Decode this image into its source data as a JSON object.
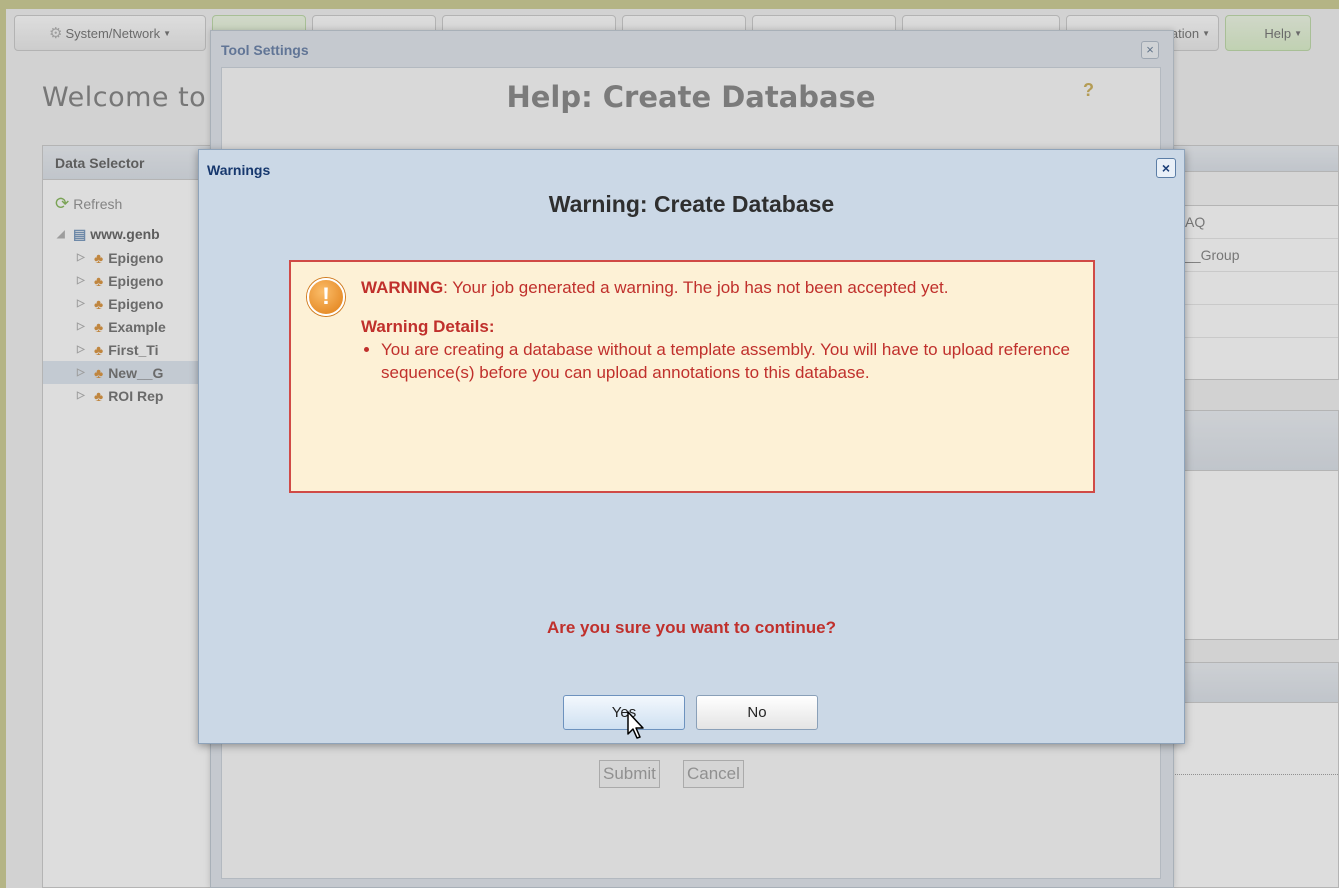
{
  "menubar": {
    "system_network": "System/Network",
    "organization": "zation",
    "help": "Help"
  },
  "welcome": "Welcome to",
  "data_selector": {
    "title": "Data Selector",
    "refresh": "Refresh",
    "root": "www.genb",
    "items": [
      "Epigeno",
      "Epigeno",
      "Epigeno",
      "Example",
      "First_Ti",
      "New__G",
      "ROI Rep"
    ],
    "selected_index": 5
  },
  "right_panel": {
    "rows": [
      "AQ",
      "__Group",
      "",
      ""
    ]
  },
  "tool_settings": {
    "title": "Tool Settings",
    "help_heading": "Help: Create Database",
    "submit": "Submit",
    "cancel": "Cancel"
  },
  "warnings": {
    "title": "Warnings",
    "heading": "Warning: Create Database",
    "warning_label": "WARNING",
    "warning_text": ": Your job generated a warning. The job has not been accepted yet.",
    "details_title": "Warning Details:",
    "details": [
      "You are creating a database without a template assembly. You will have to upload reference sequence(s) before you can upload annotations to this database."
    ],
    "question": "Are you sure you want to continue?",
    "yes": "Yes",
    "no": "No",
    "close": "×"
  }
}
